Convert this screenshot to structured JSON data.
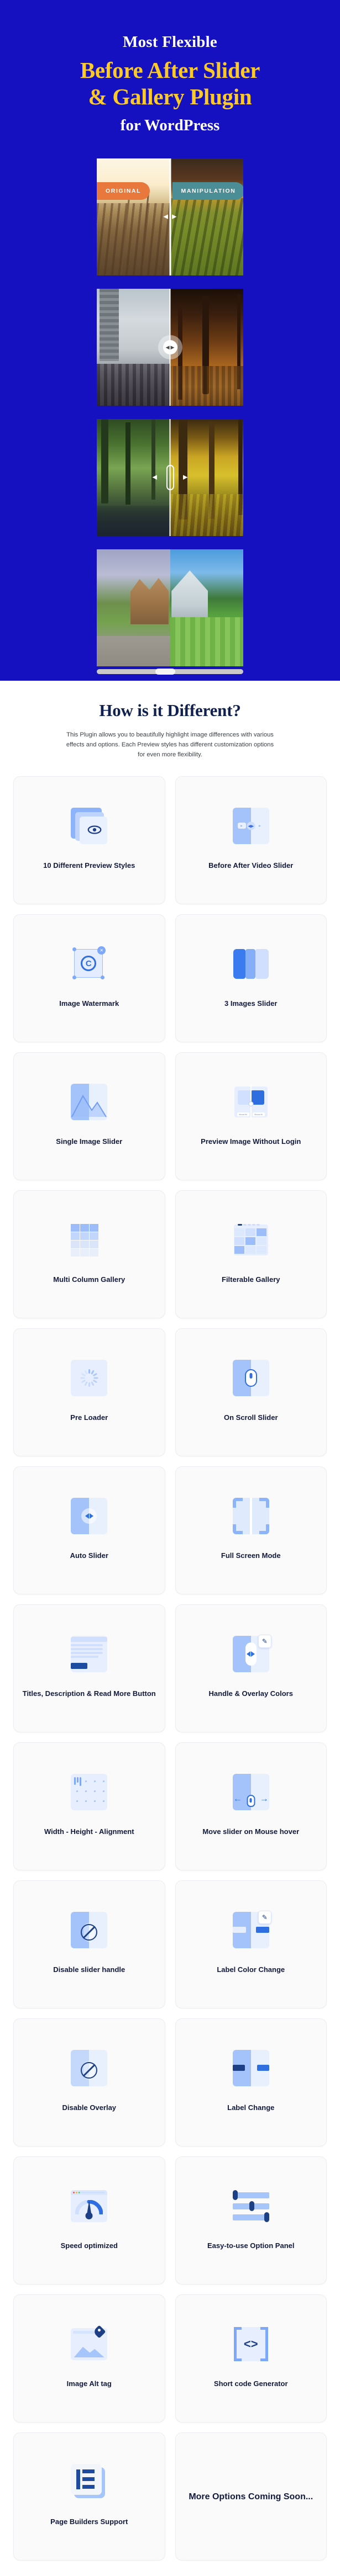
{
  "hero": {
    "line1": "Most Flexible",
    "line2": "Before After Slider",
    "line3": "& Gallery Plugin",
    "line4": "for WordPress",
    "bg_color": "#1510c0",
    "accent_color": "#fbc928",
    "sliders": [
      {
        "name": "railway-before-after",
        "label_left": "ORIGINAL",
        "label_right": "MANIPULATION",
        "handle": "arrows",
        "label_left_color": "#e8783c",
        "label_right_color": "#4b8e96"
      },
      {
        "name": "city-day-night",
        "handle": "circle-knob"
      },
      {
        "name": "forest-season",
        "handle": "pill-knob"
      },
      {
        "name": "house-renovation",
        "handle": "scrollbar"
      }
    ]
  },
  "different": {
    "heading": "How is it Different?",
    "body": "This Plugin allows you to beautifully highlight image differences with various effects and options. Each Preview styles has different customization options for even more flexibility."
  },
  "features": [
    {
      "icon": "layered-preview-eye-icon",
      "label": "10 Different Preview Styles"
    },
    {
      "icon": "video-slider-icon",
      "label": "Before After Video Slider"
    },
    {
      "icon": "copyright-watermark-icon",
      "label": "Image Watermark"
    },
    {
      "icon": "three-panels-icon",
      "label": "3 Images Slider"
    },
    {
      "icon": "mountain-image-icon",
      "label": "Single Image Slider"
    },
    {
      "icon": "preview-no-login-icon",
      "label": "Preview Image Without Login"
    },
    {
      "icon": "grid-columns-icon",
      "label": "Multi Column Gallery"
    },
    {
      "icon": "filter-grid-icon",
      "label": "Filterable Gallery"
    },
    {
      "icon": "spinner-icon",
      "label": "Pre Loader"
    },
    {
      "icon": "mouse-scroll-icon",
      "label": "On Scroll Slider"
    },
    {
      "icon": "auto-arrows-icon",
      "label": "Auto Slider"
    },
    {
      "icon": "fullscreen-corners-icon",
      "label": "Full Screen Mode"
    },
    {
      "icon": "text-lines-button-icon",
      "label": "Titles, Description & Read More Button"
    },
    {
      "icon": "handle-color-picker-icon",
      "label": "Handle & Overlay Colors"
    },
    {
      "icon": "alignment-grid-icon",
      "label": "Width - Height - Alignment"
    },
    {
      "icon": "mouse-hover-arrows-icon",
      "label": "Move slider on Mouse hover"
    },
    {
      "icon": "disabled-handle-icon",
      "label": "Disable slider handle"
    },
    {
      "icon": "label-color-picker-icon",
      "label": "Label Color Change"
    },
    {
      "icon": "disabled-overlay-icon",
      "label": "Disable Overlay"
    },
    {
      "icon": "label-swap-icon",
      "label": "Label Change"
    },
    {
      "icon": "speed-gauge-icon",
      "label": "Speed optimized"
    },
    {
      "icon": "sliders-panel-icon",
      "label": "Easy-to-use Option Panel"
    },
    {
      "icon": "image-tag-icon",
      "label": "Image Alt tag"
    },
    {
      "icon": "code-brackets-icon",
      "label": "Short code Generator"
    },
    {
      "icon": "elementor-icon",
      "label": "Page Builders Support"
    },
    {
      "icon": "none",
      "label": "More Options Coming Soon...",
      "style": "text-only"
    }
  ]
}
